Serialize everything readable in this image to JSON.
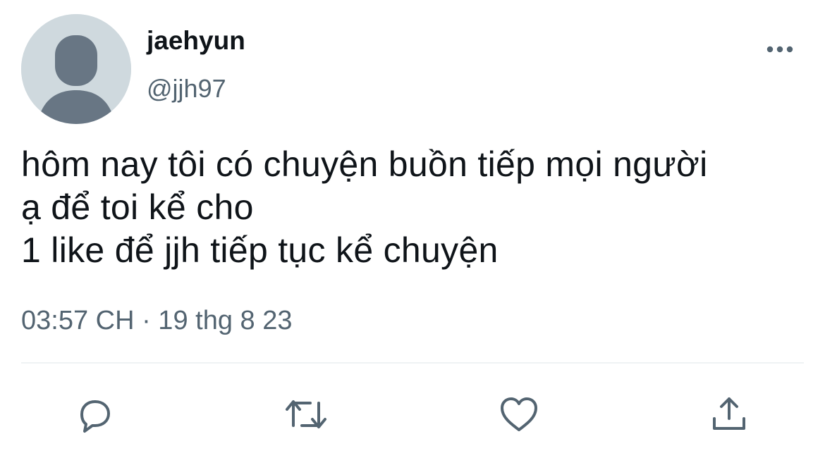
{
  "author": {
    "display_name": "jaehyun",
    "handle": "@jjh97",
    "avatar_icon": "default-profile-icon"
  },
  "tweet": {
    "lines": [
      "hôm nay tôi có chuyện buồn tiếp mọi người",
      "ạ để toi kể cho",
      "1 like để jjh tiếp tục kể chuyện"
    ],
    "timestamp": "03:57 CH · 19 thg 8 23"
  },
  "header": {
    "more_icon": "more-options-icon"
  },
  "actions": [
    {
      "name": "reply",
      "icon": "reply-bubble-icon"
    },
    {
      "name": "retweet",
      "icon": "retweet-arrows-icon"
    },
    {
      "name": "like",
      "icon": "heart-icon"
    },
    {
      "name": "share",
      "icon": "share-upload-icon"
    }
  ],
  "colors": {
    "text_primary": "#0f1419",
    "text_secondary": "#536471",
    "icon_gray": "#536471",
    "avatar_bg": "#cfd9de",
    "avatar_figure": "#687684",
    "divider": "#eff3f4"
  }
}
